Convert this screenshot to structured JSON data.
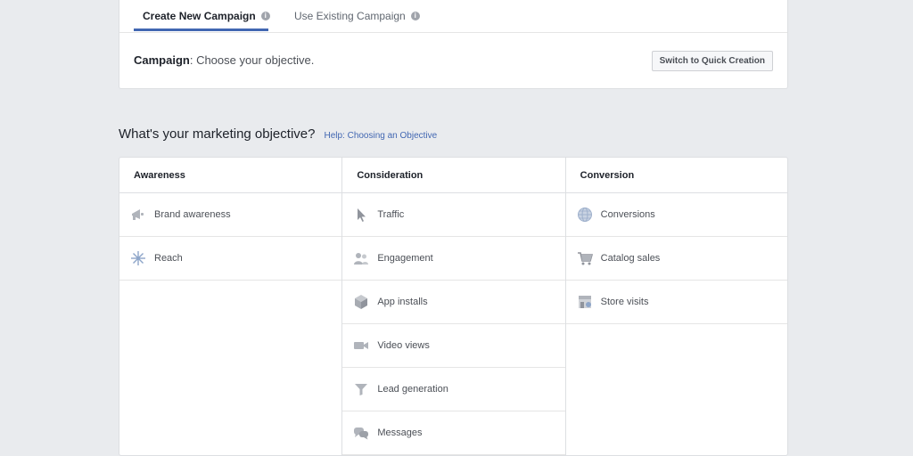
{
  "tabs": [
    {
      "label": "Create New Campaign",
      "info": "i"
    },
    {
      "label": "Use Existing Campaign",
      "info": "i"
    }
  ],
  "campaign": {
    "label": "Campaign",
    "text": ": Choose your objective."
  },
  "quick_creation_label": "Switch to Quick Creation",
  "objective": {
    "title": "What's your marketing objective?",
    "help": "Help: Choosing an Objective"
  },
  "columns": [
    {
      "title": "Awareness",
      "items": [
        {
          "label": "Brand awareness",
          "icon": "megaphone-icon"
        },
        {
          "label": "Reach",
          "icon": "asterisk-icon"
        }
      ]
    },
    {
      "title": "Consideration",
      "items": [
        {
          "label": "Traffic",
          "icon": "cursor-icon"
        },
        {
          "label": "Engagement",
          "icon": "people-icon"
        },
        {
          "label": "App installs",
          "icon": "box-icon"
        },
        {
          "label": "Video views",
          "icon": "video-camera-icon"
        },
        {
          "label": "Lead generation",
          "icon": "funnel-icon"
        },
        {
          "label": "Messages",
          "icon": "chat-bubbles-icon"
        }
      ]
    },
    {
      "title": "Conversion",
      "items": [
        {
          "label": "Conversions",
          "icon": "globe-icon"
        },
        {
          "label": "Catalog sales",
          "icon": "shopping-cart-icon"
        },
        {
          "label": "Store visits",
          "icon": "store-icon"
        }
      ]
    }
  ],
  "colors": {
    "accent": "#4267b2",
    "icon": "#90949c",
    "background": "#e9ebee"
  }
}
